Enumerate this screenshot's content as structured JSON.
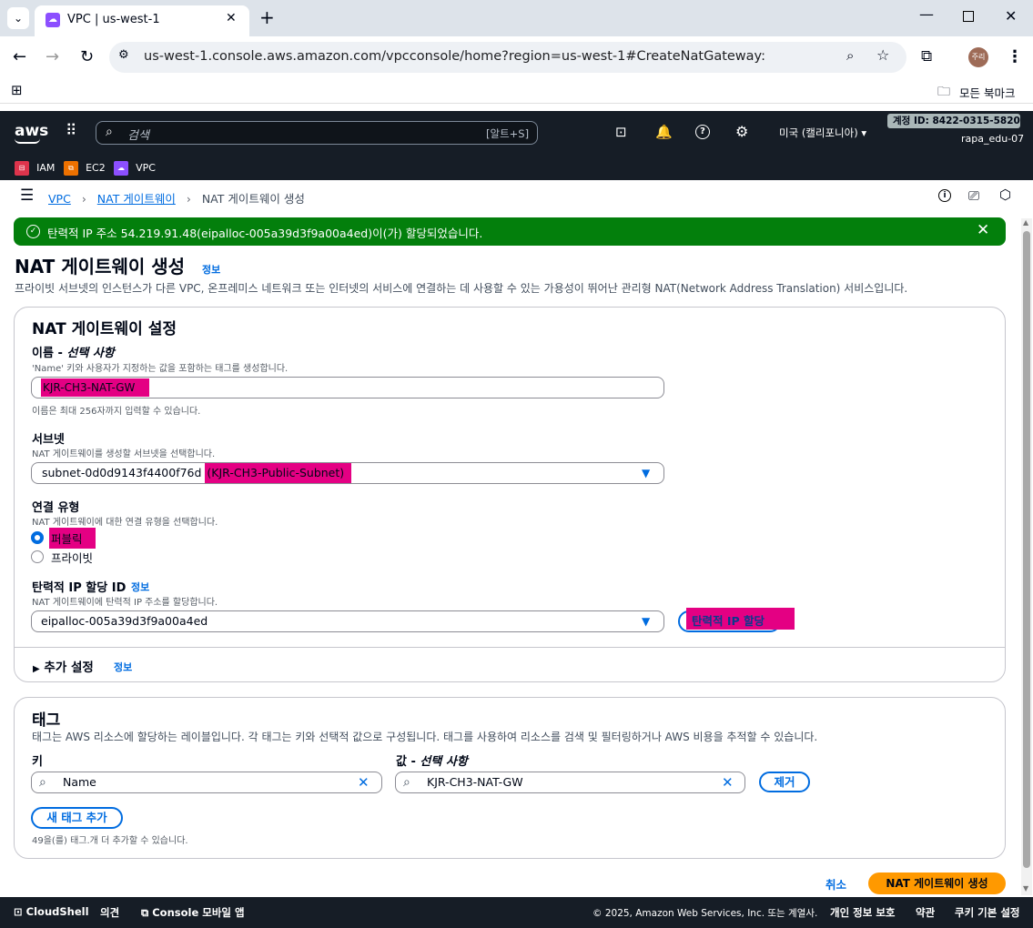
{
  "browser": {
    "tab_title": "VPC | us-west-1",
    "url": "us-west-1.console.aws.amazon.com/vpcconsole/home?region=us-west-1#CreateNatGateway:",
    "profile": "주리",
    "bookmarks_label": "모든 북마크"
  },
  "aws_header": {
    "logo": "aws",
    "search_placeholder": "검색",
    "search_shortcut": "[알트+S]",
    "region": "미국 (캘리포니아)",
    "account_id": "계정 ID: 8422-0315-5820",
    "username": "rapa_edu-07",
    "services": [
      {
        "label": "IAM",
        "color": "#dd344c"
      },
      {
        "label": "EC2",
        "color": "#ed7100"
      },
      {
        "label": "VPC",
        "color": "#8c4fff"
      }
    ]
  },
  "breadcrumb": {
    "items": [
      "VPC",
      "NAT 게이트웨이"
    ],
    "current": "NAT 게이트웨이 생성"
  },
  "flash": {
    "message": "탄력적 IP 주소 54.219.91.48(eipalloc-005a39d3f9a00a4ed)이(가) 할당되었습니다.",
    "color": "#037f0c"
  },
  "page": {
    "title": "NAT 게이트웨이 생성",
    "info": "정보",
    "description": "프라이빗 서브넷의 인스턴스가 다른 VPC, 온프레미스 네트워크 또는 인터넷의 서비스에 연결하는 데 사용할 수 있는 가용성이 뛰어난 관리형 NAT(Network Address Translation) 서비스입니다."
  },
  "settings": {
    "title": "NAT 게이트웨이 설정",
    "name_label": "이름 - ",
    "name_optional": "선택 사항",
    "name_desc": "'Name' 키와 사용자가 지정하는 값을 포함하는 태그를 생성합니다.",
    "name_value": "KJR-CH3-NAT-GW",
    "name_hint": "이름은 최대 256자까지 입력할 수 있습니다.",
    "subnet_label": "서브넷",
    "subnet_desc": "NAT 게이트웨이를 생성할 서브넷을 선택합니다.",
    "subnet_id": "subnet-0d0d9143f4400f76d",
    "subnet_name": "(KJR-CH3-Public-Subnet)",
    "conn_label": "연결 유형",
    "conn_desc": "NAT 게이트웨이에 대한 연결 유형을 선택합니다.",
    "conn_public": "퍼블릭",
    "conn_private": "프라이빗",
    "eip_label": "탄력적 IP 할당 ID",
    "eip_info": "정보",
    "eip_desc": "NAT 게이트웨이에 탄력적 IP 주소를 할당합니다.",
    "eip_value": "eipalloc-005a39d3f9a00a4ed",
    "eip_button": "탄력적 IP 할당",
    "extra_label": "추가 설정",
    "extra_info": "정보"
  },
  "tags": {
    "title": "태그",
    "desc": "태그는 AWS 리소스에 할당하는 레이블입니다. 각 태그는 키와 선택적 값으로 구성됩니다. 태그를 사용하여 리소스를 검색 및 필터링하거나 AWS 비용을 추적할 수 있습니다.",
    "key_label": "키",
    "value_label": "값 - ",
    "value_optional": "선택 사항",
    "key_value": "Name",
    "value_value": "KJR-CH3-NAT-GW",
    "remove": "제거",
    "add": "새 태그 추가",
    "remaining": "49을(를) 태그.개 더 추가할 수 있습니다."
  },
  "actions": {
    "cancel": "취소",
    "create": "NAT 게이트웨이 생성"
  },
  "footer": {
    "cloudshell": "CloudShell",
    "feedback": "의견",
    "console_app": "Console 모바일 앱",
    "copyright": "© 2025, Amazon Web Services, Inc. 또는 계열사.",
    "privacy": "개인 정보 보호",
    "terms": "약관",
    "cookies": "쿠키 기본 설정"
  }
}
